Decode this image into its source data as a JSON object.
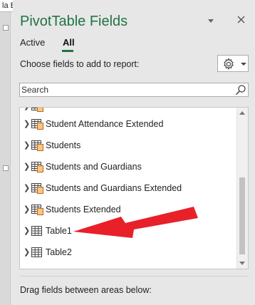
{
  "formula_bar_tab": "la Bar",
  "pane": {
    "title": "PivotTable Fields",
    "tabs": [
      {
        "label": "Active",
        "selected": false
      },
      {
        "label": "All",
        "selected": true
      }
    ],
    "choose_label": "Choose fields to add to report:",
    "search": {
      "placeholder": "Search",
      "value": ""
    },
    "fields": [
      {
        "label": "",
        "icon": "table-related-icon",
        "partial": true
      },
      {
        "label": "Student Attendance Extended",
        "icon": "table-related-icon"
      },
      {
        "label": "Students",
        "icon": "table-related-icon"
      },
      {
        "label": "Students and Guardians",
        "icon": "table-related-icon"
      },
      {
        "label": "Students and Guardians Extended",
        "icon": "table-related-icon"
      },
      {
        "label": "Students Extended",
        "icon": "table-related-icon"
      },
      {
        "label": "Table1",
        "icon": "table-icon"
      },
      {
        "label": "Table2",
        "icon": "table-icon"
      }
    ],
    "drag_label": "Drag fields between areas below:"
  },
  "colors": {
    "accent": "#217346",
    "annotation_arrow": "#e8202a"
  }
}
